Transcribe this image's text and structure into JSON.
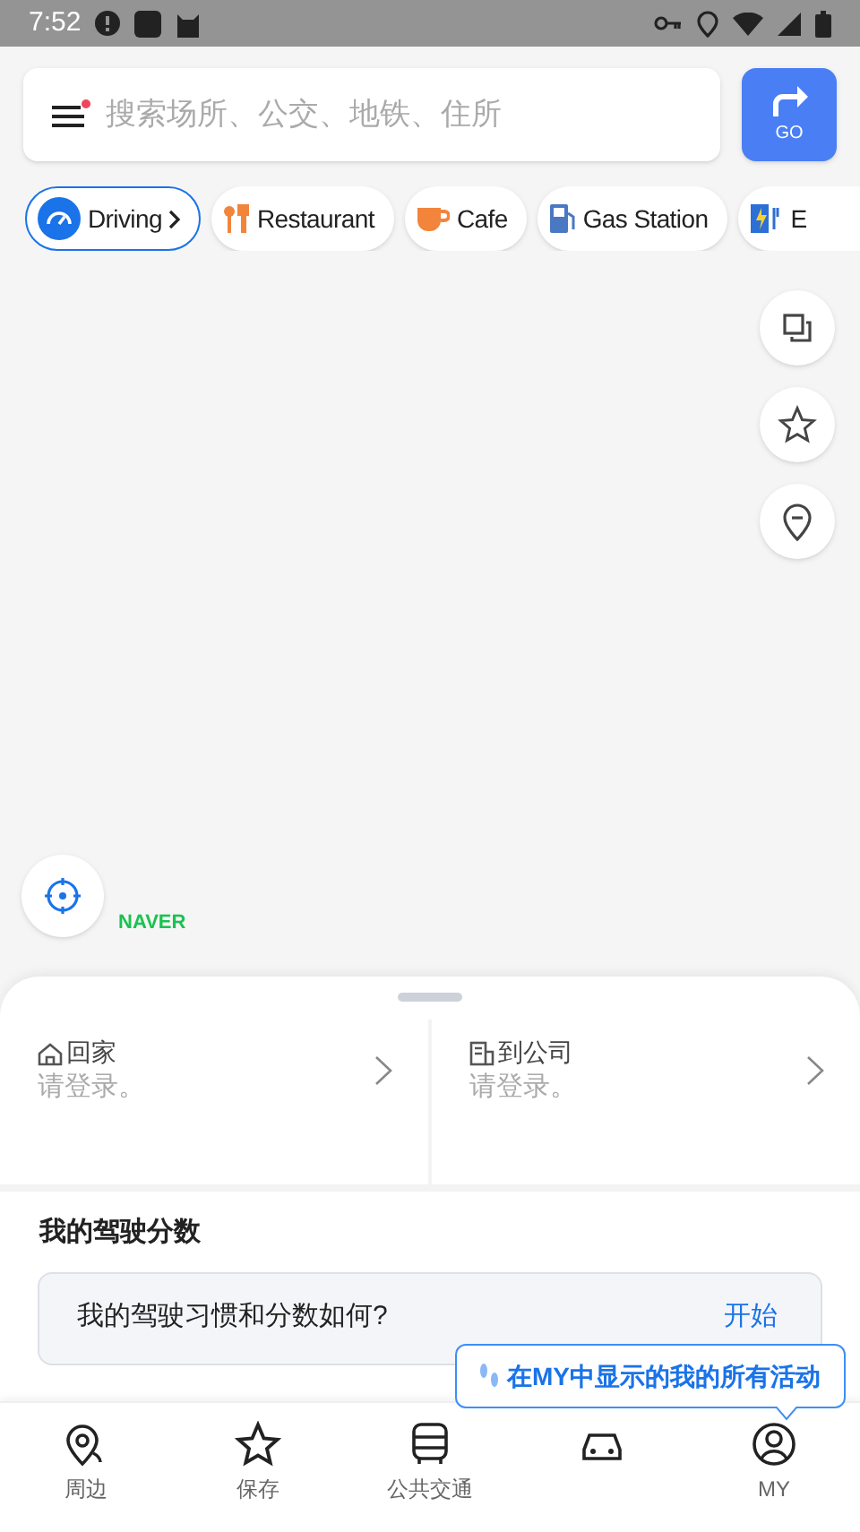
{
  "status_bar": {
    "time": "7:52"
  },
  "search": {
    "placeholder": "搜索场所、公交、地铁、住所"
  },
  "go_button": {
    "label": "GO"
  },
  "categories": [
    {
      "kind": "driving",
      "label": "Driving",
      "selected": true
    },
    {
      "kind": "restaurant",
      "label": "Restaurant",
      "selected": false
    },
    {
      "kind": "cafe",
      "label": "Cafe",
      "selected": false
    },
    {
      "kind": "gas",
      "label": "Gas Station",
      "selected": false
    },
    {
      "kind": "ev",
      "label": "E",
      "selected": false
    }
  ],
  "map_buttons": [
    {
      "kind": "layers"
    },
    {
      "kind": "favorite"
    },
    {
      "kind": "pin"
    }
  ],
  "brand": "NAVER",
  "shortcuts": [
    {
      "kind": "home",
      "title": "回家",
      "subtitle": "请登录。"
    },
    {
      "kind": "work",
      "title": "到公司",
      "subtitle": "请登录。"
    }
  ],
  "driving_score": {
    "title": "我的驾驶分数",
    "question": "我的驾驶习惯和分数如何?",
    "action": "开始"
  },
  "tooltip": {
    "text": "在MY中显示的我的所有活动"
  },
  "nav": [
    {
      "kind": "nearby",
      "label": "周边"
    },
    {
      "kind": "saved",
      "label": "保存"
    },
    {
      "kind": "transit",
      "label": "公共交通"
    },
    {
      "kind": "drive"
    },
    {
      "kind": "my",
      "label": "MY"
    }
  ]
}
